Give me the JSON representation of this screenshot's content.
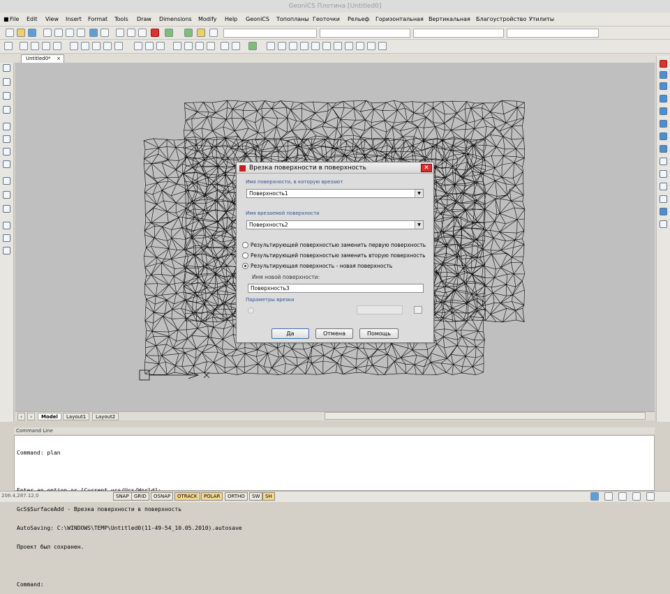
{
  "window": {
    "title": "GeoniCS Плотина [Untitled0]"
  },
  "menu": [
    "File",
    "Edit",
    "View",
    "Insert",
    "Format",
    "Tools",
    "Draw",
    "Dimensions",
    "Modify",
    "Help",
    "GeoniCS",
    "Топопланы",
    "Геоточки",
    "Рельеф",
    "Горизонтальная",
    "Вертикальная",
    "Благоустройство",
    "Утилиты"
  ],
  "doc_tab": {
    "label": "Untitled0*",
    "close": "×"
  },
  "layout_tabs": [
    "Model",
    "Layout1",
    "Layout2"
  ],
  "nav": {
    "first": "‹",
    "next": "›"
  },
  "command": {
    "header": "Command Line",
    "lines": [
      "Command: plan",
      "",
      "Enter an option or [Current ucs/Ucs/World]:",
      "GcS$SurfaceAdd - Врезка поверхности в поверхность",
      "AutoSaving: C:\\WINDOWS\\TEMP\\Untitled0(11-49-54_10.05.2010).autosave",
      "Проект был сохранен.",
      "",
      "Command:"
    ]
  },
  "status": {
    "coords": "208.4,287.12,0",
    "buttons": [
      {
        "label": "SNAP",
        "on": false
      },
      {
        "label": "GRID",
        "on": false
      },
      {
        "label": "OSNAP",
        "on": false
      },
      {
        "label": "OTRACK",
        "on": true
      },
      {
        "label": "POLAR",
        "on": true
      },
      {
        "label": "ORTHO",
        "on": false
      },
      {
        "label": "SW",
        "on": false
      },
      {
        "label": "SH",
        "on": true
      }
    ]
  },
  "dialog": {
    "title": "Врезка поверхности в поверхность",
    "close": "✕",
    "target_label": "Имя поверхности, в которую врезают",
    "target_value": "Поверхность1",
    "insert_label": "Имя врезаемой поверхности",
    "insert_value": "Поверхность2",
    "radios": [
      {
        "label": "Результирующей поверхностью заменить первую поверхность",
        "checked": false
      },
      {
        "label": "Результирующей поверхностью заменить вторую поверхность",
        "checked": false
      },
      {
        "label": "Результирующая поверхность - новая поверхность",
        "checked": true
      }
    ],
    "new_name_label": "Имя новой поверхности:",
    "new_name_value": "Поверхность3",
    "params_label": "Параметры врезки",
    "ok": "Да",
    "cancel": "Отмена",
    "help": "Помощь"
  },
  "colors": {
    "canvas": "#bfbfbf",
    "accent": "#c81e1e",
    "link": "#3050a0"
  }
}
